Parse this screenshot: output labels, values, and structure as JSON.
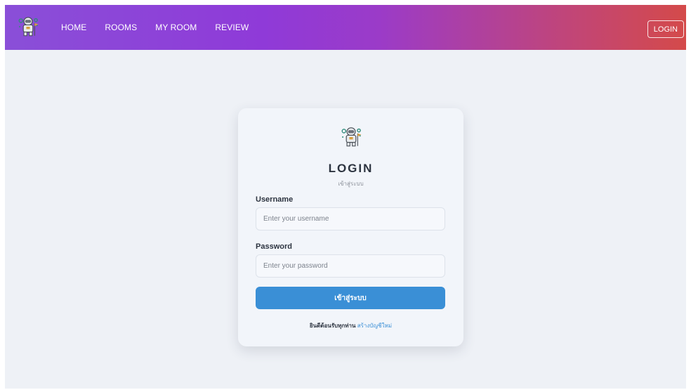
{
  "navbar": {
    "brand_icon": "astronaut-icon",
    "links": [
      {
        "label": "HOME"
      },
      {
        "label": "ROOMS"
      },
      {
        "label": "MY ROOM"
      },
      {
        "label": "REVIEW"
      }
    ],
    "login_label": "LOGIN"
  },
  "login_card": {
    "logo_icon": "astronaut-icon",
    "title": "LOGIN",
    "subtitle": "เข้าสู่ระบบ",
    "username_label": "Username",
    "username_placeholder": "Enter your username",
    "username_value": "",
    "password_label": "Password",
    "password_placeholder": "Enter your password",
    "password_value": "",
    "submit_label": "เข้าสู่ระบบ",
    "footer_text": "ยินดีต้อนรับทุกท่าน",
    "register_link": "สร้างบัญชีใหม่"
  },
  "colors": {
    "nav_gradient_start": "#8a4fd8",
    "nav_gradient_end": "#d44a4a",
    "page_background": "#eef1f6",
    "card_background": "#f2f5fa",
    "primary_button": "#3a8fd6",
    "link": "#3a8fd6"
  }
}
